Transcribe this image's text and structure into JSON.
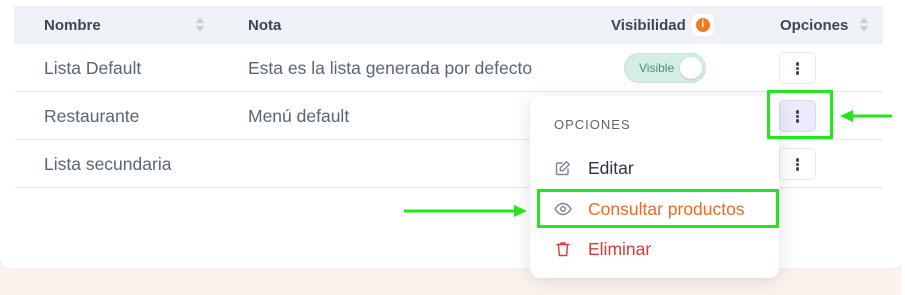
{
  "table": {
    "headers": {
      "name": "Nombre",
      "note": "Nota",
      "visibility": "Visibilidad",
      "visibility_info": "i",
      "options": "Opciones"
    },
    "rows": [
      {
        "name": "Lista Default",
        "note": "Esta es la lista generada por defecto",
        "visibility": "Visible"
      },
      {
        "name": "Restaurante",
        "note": "Menú default",
        "visibility": ""
      },
      {
        "name": "Lista secundaria",
        "note": "",
        "visibility": ""
      }
    ]
  },
  "dropdown": {
    "header": "OPCIONES",
    "items": [
      {
        "label": "Editar",
        "icon": "edit-icon",
        "color": "#2b3240"
      },
      {
        "label": "Consultar productos",
        "icon": "eye-icon",
        "color": "#ee6a1d"
      },
      {
        "label": "Eliminar",
        "icon": "trash-icon",
        "color": "#d93a3a"
      }
    ]
  },
  "colors": {
    "annotation": "#25e61c",
    "accent_orange": "#ef7a22",
    "toggle_bg": "#d4ede6",
    "danger": "#d93a3a"
  }
}
